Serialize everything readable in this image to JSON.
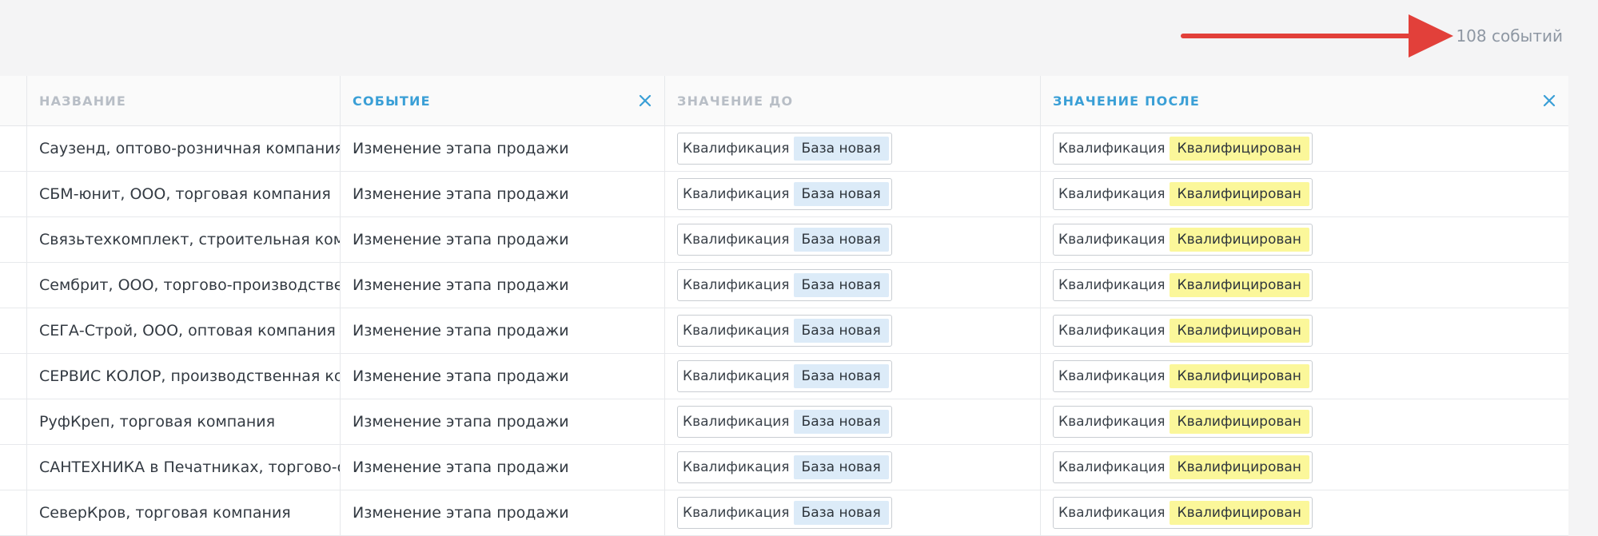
{
  "colors": {
    "accent": "#3a9fd6",
    "arrow": "#e2403a",
    "tag_before": "#dcebf8",
    "tag_after": "#fbf79a"
  },
  "summary": {
    "event_count": "108 событий"
  },
  "table": {
    "columns": {
      "name": "НАЗВАНИЕ",
      "event": "СОБЫТИЕ",
      "value_before": "ЗНАЧЕНИЕ ДО",
      "value_after": "ЗНАЧЕНИЕ ПОСЛЕ"
    },
    "rows": [
      {
        "name": "Саузенд, оптово-розничная компания",
        "event": "Изменение этапа продажи",
        "before_label": "Квалификация",
        "before_value": "База новая",
        "after_label": "Квалификация",
        "after_value": "Квалифицирован"
      },
      {
        "name": "СБМ-юнит, ООО, торговая компания",
        "event": "Изменение этапа продажи",
        "before_label": "Квалификация",
        "before_value": "База новая",
        "after_label": "Квалификация",
        "after_value": "Квалифицирован"
      },
      {
        "name": "Связьтехкомплект, строительная компания",
        "event": "Изменение этапа продажи",
        "before_label": "Квалификация",
        "before_value": "База новая",
        "after_label": "Квалификация",
        "after_value": "Квалифицирован"
      },
      {
        "name": "Сембрит, ООО, торгово-производственная компания",
        "event": "Изменение этапа продажи",
        "before_label": "Квалификация",
        "before_value": "База новая",
        "after_label": "Квалификация",
        "after_value": "Квалифицирован"
      },
      {
        "name": "СЕГА-Строй, ООО, оптовая компания",
        "event": "Изменение этапа продажи",
        "before_label": "Квалификация",
        "before_value": "База новая",
        "after_label": "Квалификация",
        "after_value": "Квалифицирован"
      },
      {
        "name": "СЕРВИС КОЛОР, производственная компания",
        "event": "Изменение этапа продажи",
        "before_label": "Квалификация",
        "before_value": "База новая",
        "after_label": "Квалификация",
        "after_value": "Квалифицирован"
      },
      {
        "name": "РуфКреп, торговая компания",
        "event": "Изменение этапа продажи",
        "before_label": "Квалификация",
        "before_value": "База новая",
        "after_label": "Квалификация",
        "after_value": "Квалифицирован"
      },
      {
        "name": "САНТЕХНИКА в Печатниках, торгово-сервисная компания",
        "event": "Изменение этапа продажи",
        "before_label": "Квалификация",
        "before_value": "База новая",
        "after_label": "Квалификация",
        "after_value": "Квалифицирован"
      },
      {
        "name": "СеверКров, торговая компания",
        "event": "Изменение этапа продажи",
        "before_label": "Квалификация",
        "before_value": "База новая",
        "after_label": "Квалификация",
        "after_value": "Квалифицирован"
      }
    ]
  }
}
